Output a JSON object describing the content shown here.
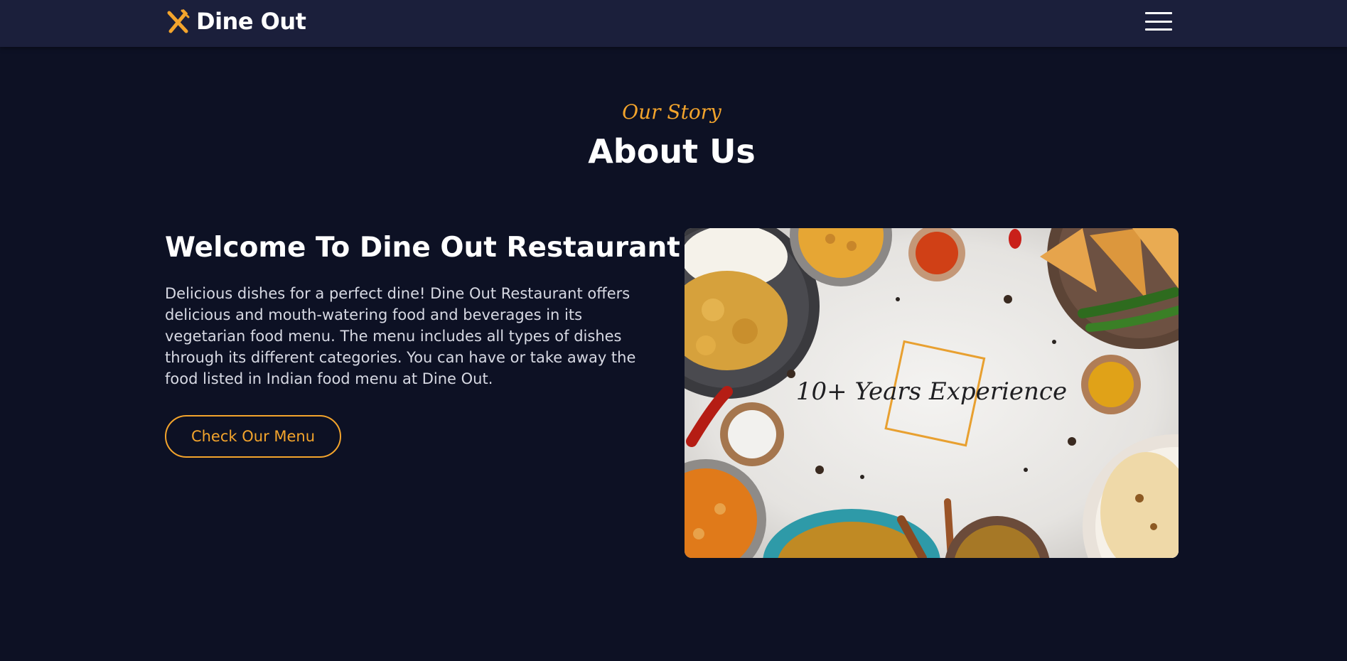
{
  "navbar": {
    "brand_name": "Dine Out",
    "brand_icon": "utensils-icon",
    "menu_icon": "hamburger-menu-icon"
  },
  "about": {
    "subtitle": "Our Story",
    "title": "About Us",
    "heading": "Welcome To Dine Out Restaurant",
    "description": "Delicious dishes for a perfect dine! Dine Out Restaurant offers delicious and mouth-watering food and beverages in its vegetarian food menu. The menu includes all types of dishes through its different categories. You can have or take away the food listed in Indian food menu at Dine Out.",
    "button_label": "Check Our Menu",
    "image_caption": "10+ Years Experience"
  },
  "colors": {
    "background": "#0d1124",
    "navbar": "#1b1f3b",
    "accent": "#f3a42c",
    "text": "#ffffff"
  }
}
